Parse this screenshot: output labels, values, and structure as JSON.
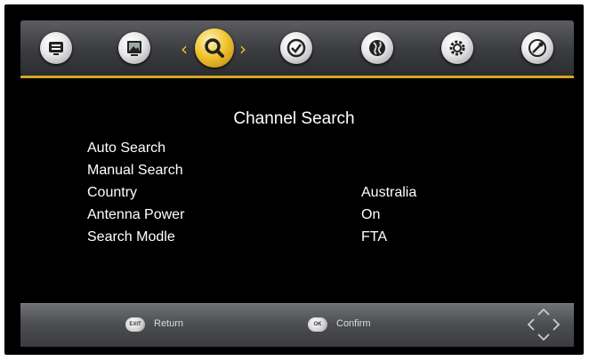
{
  "top_tabs": [
    {
      "icon": "program-list-icon"
    },
    {
      "icon": "picture-icon"
    },
    {
      "icon": "search-icon",
      "active": true
    },
    {
      "icon": "clock-icon"
    },
    {
      "icon": "globe-icon"
    },
    {
      "icon": "gear-icon"
    },
    {
      "icon": "tools-icon"
    }
  ],
  "page": {
    "title": "Channel Search"
  },
  "menu": [
    {
      "label": "Auto Search",
      "value": ""
    },
    {
      "label": "Manual Search",
      "value": ""
    },
    {
      "label": "Country",
      "value": "Australia"
    },
    {
      "label": "Antenna Power",
      "value": "On"
    },
    {
      "label": "Search Modle",
      "value": "FTA"
    }
  ],
  "footer": {
    "exit_key": "EXIT",
    "exit_label": "Return",
    "ok_key": "OK",
    "ok_label": "Confirm"
  },
  "colors": {
    "accent": "#d9a521",
    "background": "#000000",
    "text": "#ffffff"
  }
}
